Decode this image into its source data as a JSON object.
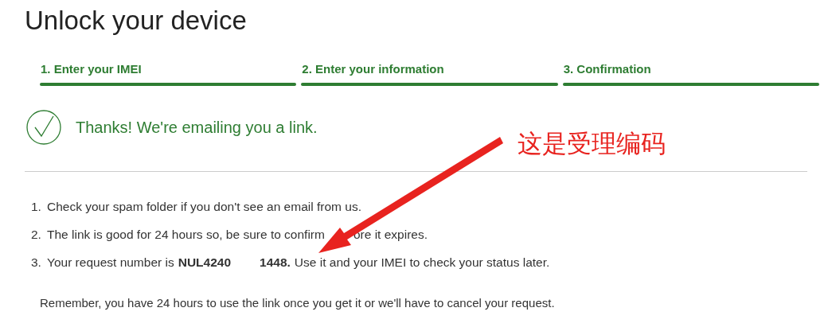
{
  "title": "Unlock your device",
  "steps": [
    {
      "label": "1. Enter your IMEI"
    },
    {
      "label": "2. Enter your information"
    },
    {
      "label": "3. Confirmation"
    }
  ],
  "message": "Thanks! We're emailing you a link.",
  "list": [
    {
      "number": "1.",
      "parts": [
        {
          "text": "Check your spam folder if you don't see an email from us."
        }
      ]
    },
    {
      "number": "2.",
      "parts": [
        {
          "text": "The link is good for 24 hours so, be sure to confirm"
        },
        {
          "text": "ore it expires.",
          "gap": true
        }
      ]
    },
    {
      "number": "3.",
      "parts": [
        {
          "text": "Your request number is"
        },
        {
          "text": "NUL4240",
          "bold": true
        },
        {
          "text": "1448.",
          "bold": true,
          "gap": true
        },
        {
          "text": "Use it and your IMEI to check your status later."
        }
      ]
    }
  ],
  "reminder": "Remember, you have 24 hours to use the link once you get it or we'll have to cancel your request.",
  "annotation": {
    "text": "这是受理编码"
  }
}
